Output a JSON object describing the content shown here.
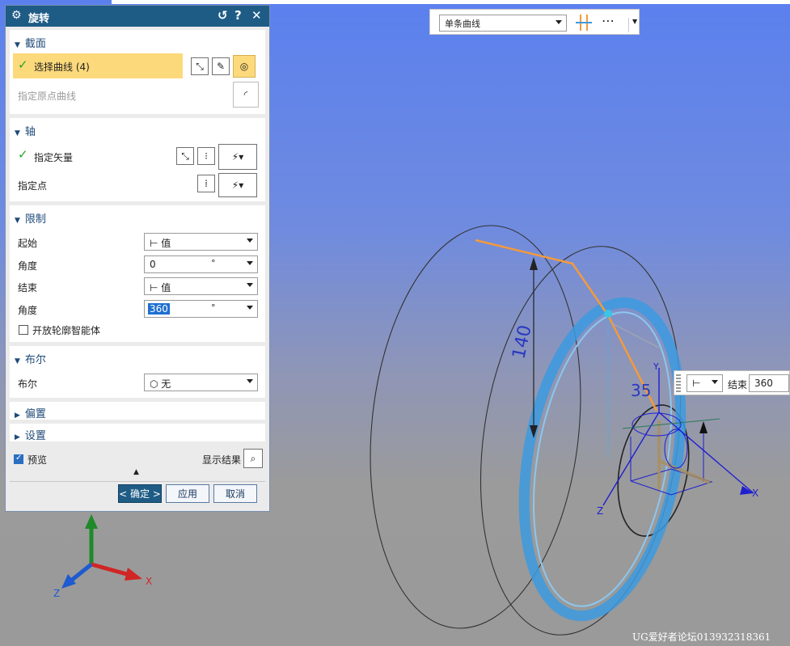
{
  "dialog": {
    "title": "旋转",
    "sections": {
      "section": {
        "header": "截面",
        "select_curve_label": "选择曲线 (4)",
        "origin_curve_label": "指定原点曲线"
      },
      "axis": {
        "header": "轴",
        "vector_label": "指定矢量",
        "point_label": "指定点"
      },
      "limits": {
        "header": "限制",
        "start_label": "起始",
        "start_type": "值",
        "start_angle_label": "角度",
        "start_angle": "0",
        "end_label": "结束",
        "end_type": "值",
        "end_angle_label": "角度",
        "end_angle": "360",
        "unit": "°",
        "open_profile_label": "开放轮廓智能体"
      },
      "boolean": {
        "header": "布尔",
        "label": "布尔",
        "value": "无"
      },
      "offset": {
        "header": "偏置"
      },
      "settings": {
        "header": "设置"
      }
    },
    "preview_label": "预览",
    "preview_checked": true,
    "show_result_label": "显示结果",
    "buttons": {
      "ok": "< 确定 >",
      "apply": "应用",
      "cancel": "取消"
    }
  },
  "toolbar": {
    "curve_rule": "单条曲线"
  },
  "float_panel": {
    "end_label": "结束",
    "end_value": "360"
  },
  "viewport": {
    "dimension_label": "140",
    "axis_labels": {
      "x": "X",
      "y": "Y",
      "z": "Z"
    },
    "dim_fragment": "35"
  },
  "triad": {
    "x": "X",
    "z": "Z"
  },
  "watermark": "UG爱好者论坛013932318361",
  "colors": {
    "title_bar": "#1e5c86",
    "highlight": "#fcd97a",
    "curve_orange": "#f39a3c",
    "ring_blue": "#3c9ae0"
  }
}
